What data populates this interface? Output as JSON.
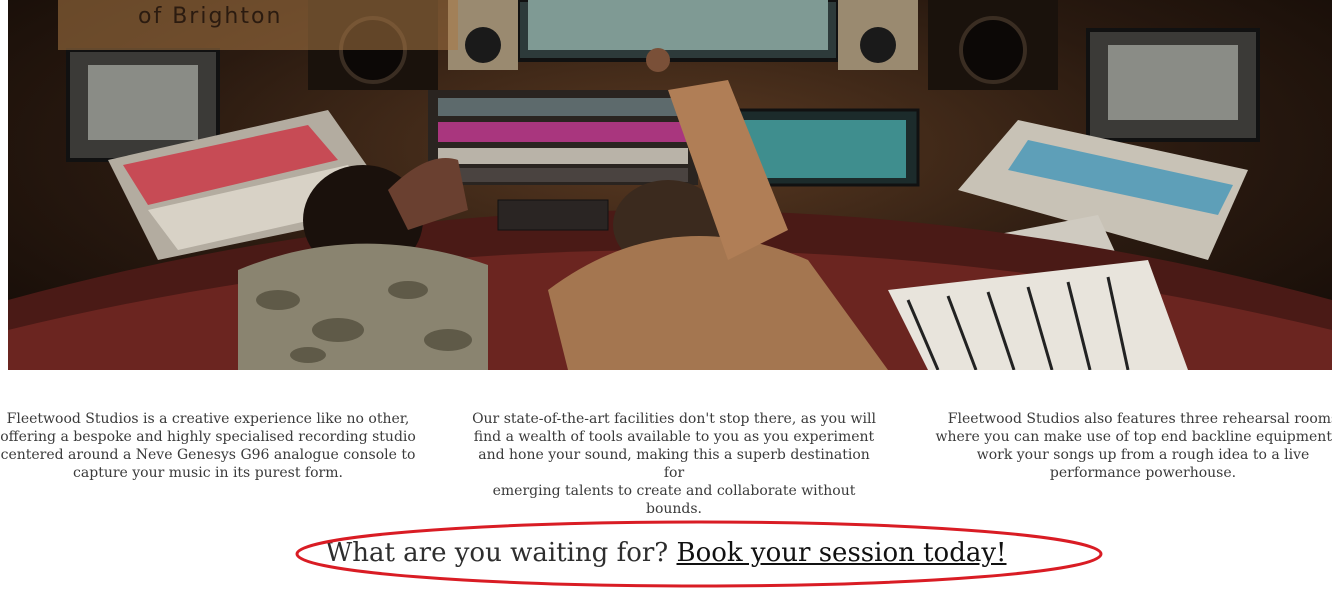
{
  "hero": {
    "subtitle": "of Brighton",
    "image_alt": "studio-photo"
  },
  "features": [
    {
      "text": "Fleetwood Studios is a creative experience like no other,\noffering a bespoke and highly specialised recording studio\ncentered around a Neve Genesys G96 analogue console to\ncapture your music in its purest form."
    },
    {
      "text": "Our state-of-the-art facilities don't stop there, as you will\nfind a wealth of tools available to you as you experiment\nand hone your sound, making this a superb destination for\nemerging talents to create and collaborate without bounds."
    },
    {
      "text": "Fleetwood Studios also features three rehearsal rooms\nwhere you can make use of top end backline equipment to\nwork your songs up from a rough idea to a live\nperformance powerhouse."
    }
  ],
  "cta": {
    "prompt": "What are you waiting for?",
    "link": "Book your session today!"
  },
  "colors": {
    "annotation_ring": "#d91c24",
    "text": "#3a3a3a"
  }
}
